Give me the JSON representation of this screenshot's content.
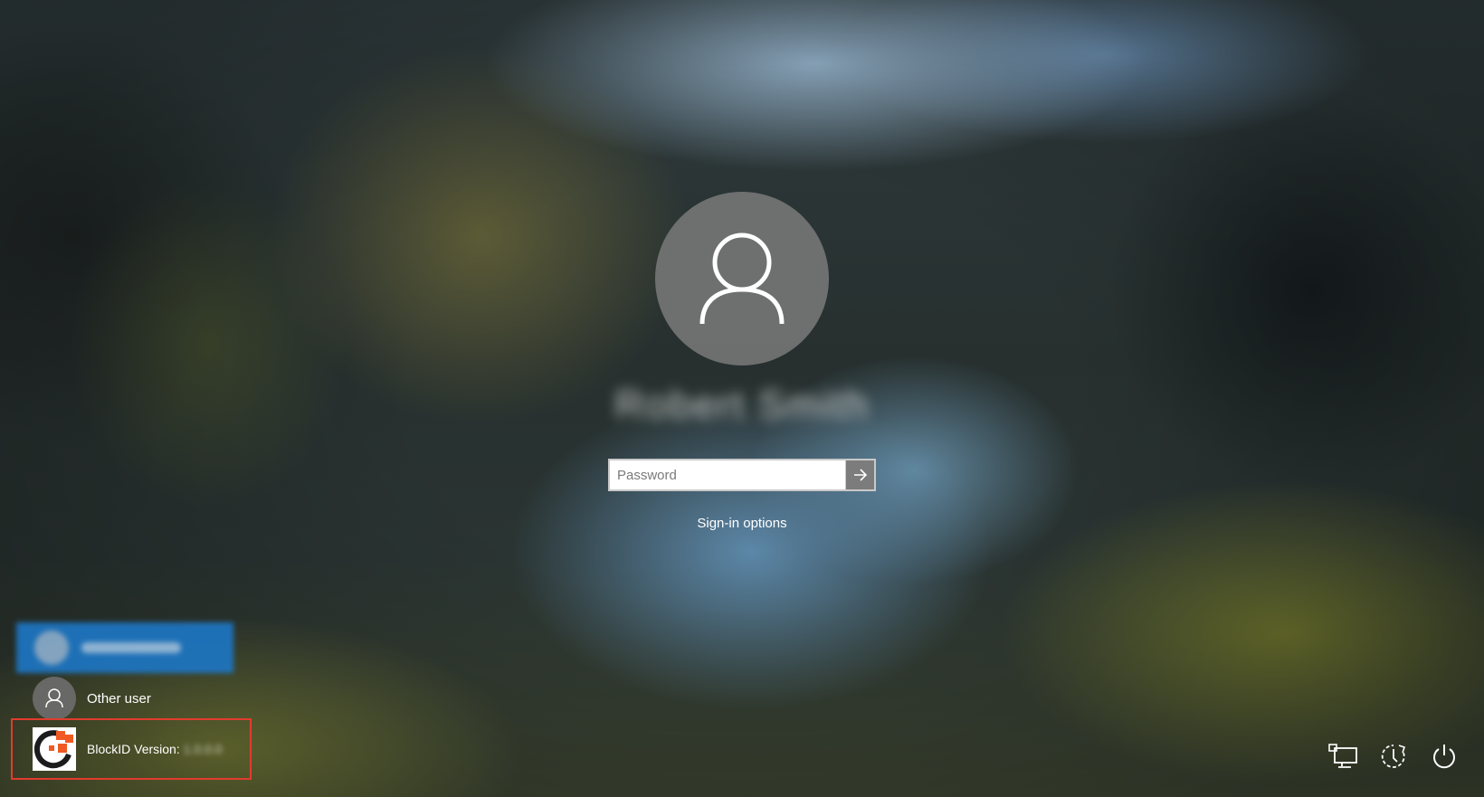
{
  "login": {
    "username": "Robert Smith",
    "password_placeholder": "Password",
    "submit_icon": "arrow-right-icon",
    "signin_options_label": "Sign-in options"
  },
  "users": {
    "selected_user_icon": "user-avatar-icon",
    "other_user_label": "Other user"
  },
  "blockid": {
    "label": "BlockID Version:",
    "version": "1.0.0.0",
    "highlight_color": "#e23b2e",
    "logo_colors": [
      "#1c1c1c",
      "#f05a22"
    ]
  },
  "corner": {
    "icons": [
      "network-icon",
      "accessibility-icon",
      "power-icon"
    ]
  },
  "colors": {
    "selected_user_bg": "#1d77c6",
    "avatar_bg": "#787878"
  }
}
